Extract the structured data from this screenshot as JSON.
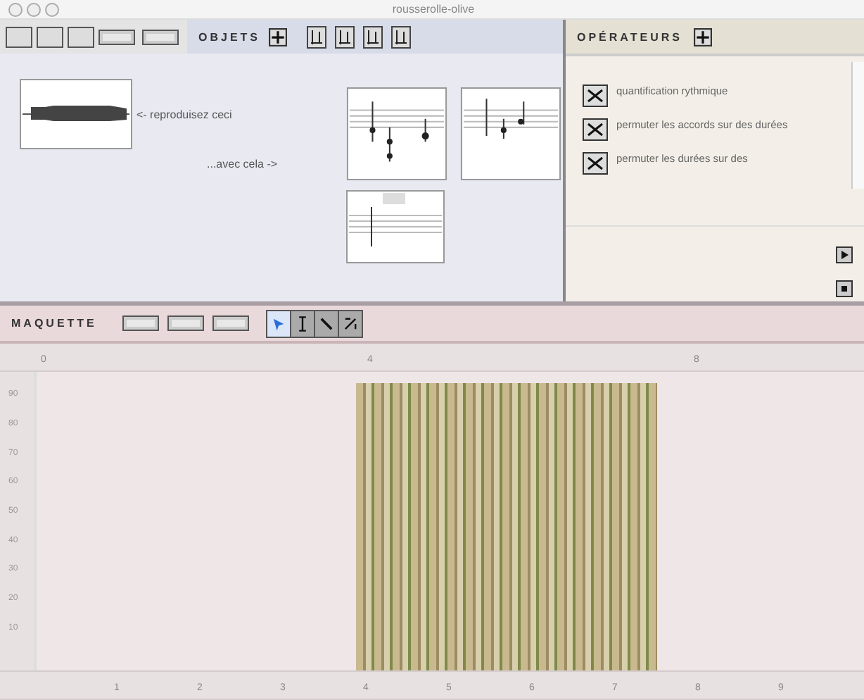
{
  "window": {
    "title": "rousserolle-olive"
  },
  "objects_panel": {
    "title": "OBJETS",
    "prompt": "<- reproduisez ceci",
    "answer_prompt": "...avec cela ->"
  },
  "operators_panel": {
    "title": "OPÉRATEURS",
    "items": [
      {
        "label": "quantification rythmique"
      },
      {
        "label": "permuter les accords sur des durées"
      },
      {
        "label": "permuter les durées sur des"
      }
    ]
  },
  "maquette": {
    "title": "MAQUETTE",
    "tools": [
      {
        "kind": "arrow",
        "selected": true
      },
      {
        "kind": "ibeam",
        "selected": false
      },
      {
        "kind": "zoom",
        "selected": false
      },
      {
        "kind": "resize",
        "selected": false
      }
    ],
    "top_ruler": [
      "0",
      "4",
      "8"
    ],
    "left_ruler": [
      "90",
      "80",
      "70",
      "60",
      "50",
      "40",
      "30",
      "20",
      "10"
    ],
    "bottom_ruler": [
      "1",
      "2",
      "3",
      "4",
      "5",
      "6",
      "7",
      "8",
      "9"
    ]
  }
}
